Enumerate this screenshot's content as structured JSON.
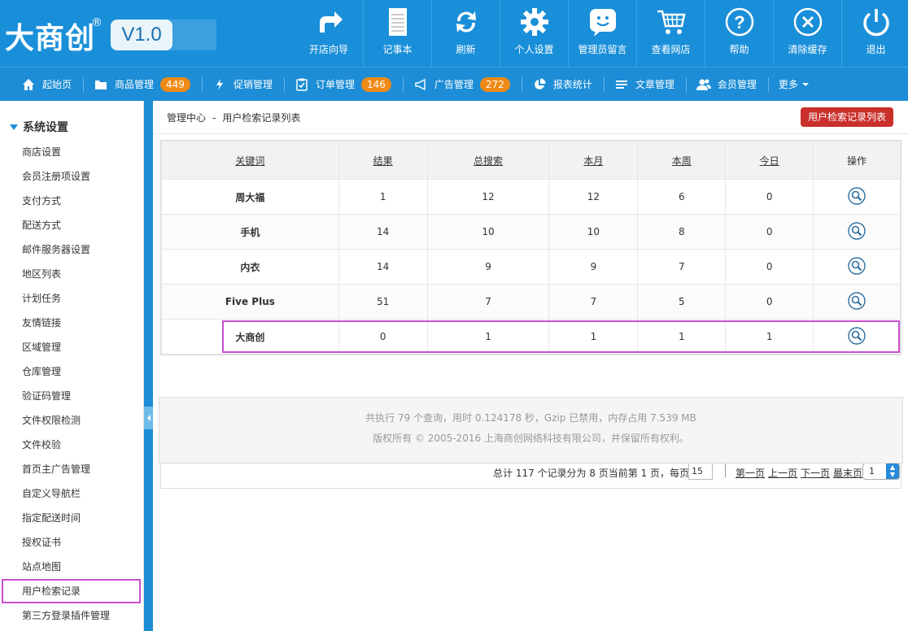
{
  "logo": {
    "text": "大商创",
    "reg": "®",
    "version": "V1.0"
  },
  "topnav": [
    {
      "name": "open-store-guide",
      "label": "开店向导",
      "icon": "forward-arrow-icon"
    },
    {
      "name": "notepad",
      "label": "记事本",
      "icon": "notepad-icon"
    },
    {
      "name": "refresh",
      "label": "刷新",
      "icon": "refresh-icon"
    },
    {
      "name": "personal-settings",
      "label": "个人设置",
      "icon": "gear-icon"
    },
    {
      "name": "admin-messages",
      "label": "管理员留言",
      "icon": "smiley-chat-icon"
    },
    {
      "name": "view-store",
      "label": "查看网店",
      "icon": "cart-icon"
    },
    {
      "name": "help",
      "label": "帮助",
      "icon": "question-icon"
    },
    {
      "name": "clear-cache",
      "label": "清除缓存",
      "icon": "close-circle-icon"
    },
    {
      "name": "logout",
      "label": "退出",
      "icon": "power-icon"
    }
  ],
  "menubar": [
    {
      "name": "home",
      "label": "起始页",
      "icon": "home-icon"
    },
    {
      "name": "goods",
      "label": "商品管理",
      "icon": "folder-icon",
      "badge": "449"
    },
    {
      "name": "promotion",
      "label": "促销管理",
      "icon": "lightning-icon"
    },
    {
      "name": "orders",
      "label": "订单管理",
      "icon": "clipboard-icon",
      "badge": "146"
    },
    {
      "name": "ads",
      "label": "广告管理",
      "icon": "megaphone-icon",
      "badge": "272"
    },
    {
      "name": "reports",
      "label": "报表统计",
      "icon": "pie-chart-icon"
    },
    {
      "name": "articles",
      "label": "文章管理",
      "icon": "list-icon"
    },
    {
      "name": "members",
      "label": "会员管理",
      "icon": "users-icon"
    },
    {
      "name": "more",
      "label": "更多"
    }
  ],
  "sidebar": {
    "title": "系统设置",
    "items": [
      "商店设置",
      "会员注册项设置",
      "支付方式",
      "配送方式",
      "邮件服务器设置",
      "地区列表",
      "计划任务",
      "友情链接",
      "区域管理",
      "仓库管理",
      "验证码管理",
      "文件权限检测",
      "文件校验",
      "首页主广告管理",
      "自定义导航栏",
      "指定配送时间",
      "授权证书",
      "站点地图",
      "用户检索记录",
      "第三方登录插件管理"
    ],
    "active_index": 18
  },
  "breadcrumb": {
    "root": "管理中心",
    "sep": "-",
    "current": "用户检索记录列表"
  },
  "title_button": "用户检索记录列表",
  "table": {
    "headers": [
      "关键词",
      "结果",
      "总搜索",
      "本月",
      "本周",
      "今日",
      "操作"
    ],
    "rows": [
      {
        "keyword": "周大福",
        "results": "1",
        "total": "12",
        "month": "12",
        "week": "6",
        "today": "0"
      },
      {
        "keyword": "手机",
        "results": "14",
        "total": "10",
        "month": "10",
        "week": "8",
        "today": "0"
      },
      {
        "keyword": "内衣",
        "results": "14",
        "total": "9",
        "month": "9",
        "week": "7",
        "today": "0"
      },
      {
        "keyword": "Five Plus",
        "results": "51",
        "total": "7",
        "month": "7",
        "week": "5",
        "today": "0"
      },
      {
        "keyword": "大商创",
        "results": "0",
        "total": "1",
        "month": "1",
        "week": "1",
        "today": "1"
      }
    ]
  },
  "pager": {
    "info": "总计 117 个记录分为 8 页当前第 1 页，每页",
    "per_page": "15",
    "first": "第一页",
    "prev": "上一页",
    "next": "下一页",
    "last": "最末页",
    "page_select": "1"
  },
  "footer": {
    "line1": "共执行 79 个查询，用时 0.124178 秒，Gzip 已禁用，内存占用 7.539 MB",
    "line2": "版权所有 © 2005-2016 上海商创网络科技有限公司，并保留所有权利。"
  },
  "colors": {
    "primary": "#1a8fd9",
    "badge": "#f08a16",
    "title_button": "#c9302c",
    "highlight": "#c94fd0"
  }
}
